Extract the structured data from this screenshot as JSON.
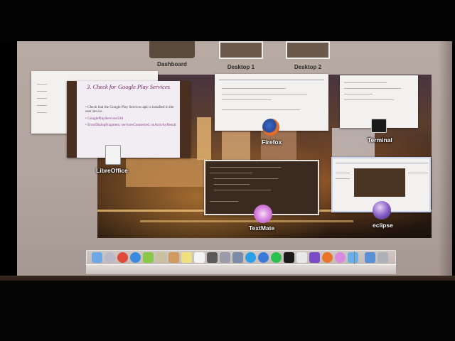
{
  "spaces": [
    {
      "label": "Dashboard"
    },
    {
      "label": "Desktop 1"
    },
    {
      "label": "Desktop 2"
    }
  ],
  "windows": {
    "libreoffice": {
      "label": "LibreOffice",
      "slide_title": "3. Check for Google Play Services",
      "bullets": [
        "Check that the Google Play Services apk is installed in the user device.",
        "GooglePlayServicesUtil",
        "ErrorDialogFragment, servicesConnected, onActivityResult"
      ]
    },
    "firefox": {
      "label": "Firefox"
    },
    "terminal": {
      "label": "Terminal"
    },
    "textmate": {
      "label": "TextMate"
    },
    "eclipse": {
      "label": "eclipse"
    }
  },
  "dock": {
    "icons": [
      "finder-icon",
      "launchpad-icon",
      "chrome-icon",
      "safari-icon",
      "android-icon",
      "preview-icon",
      "photos-icon",
      "notes-icon",
      "textedit-icon",
      "activity-monitor-icon",
      "system-preferences-icon",
      "utilities-icon",
      "skype-icon",
      "app-store-icon",
      "spotify-icon",
      "terminal-icon",
      "documents-icon",
      "eclipse-icon",
      "firefox-icon",
      "textmate-icon",
      "downloads-folder-icon",
      "applications-folder-icon",
      "trash-icon"
    ]
  }
}
